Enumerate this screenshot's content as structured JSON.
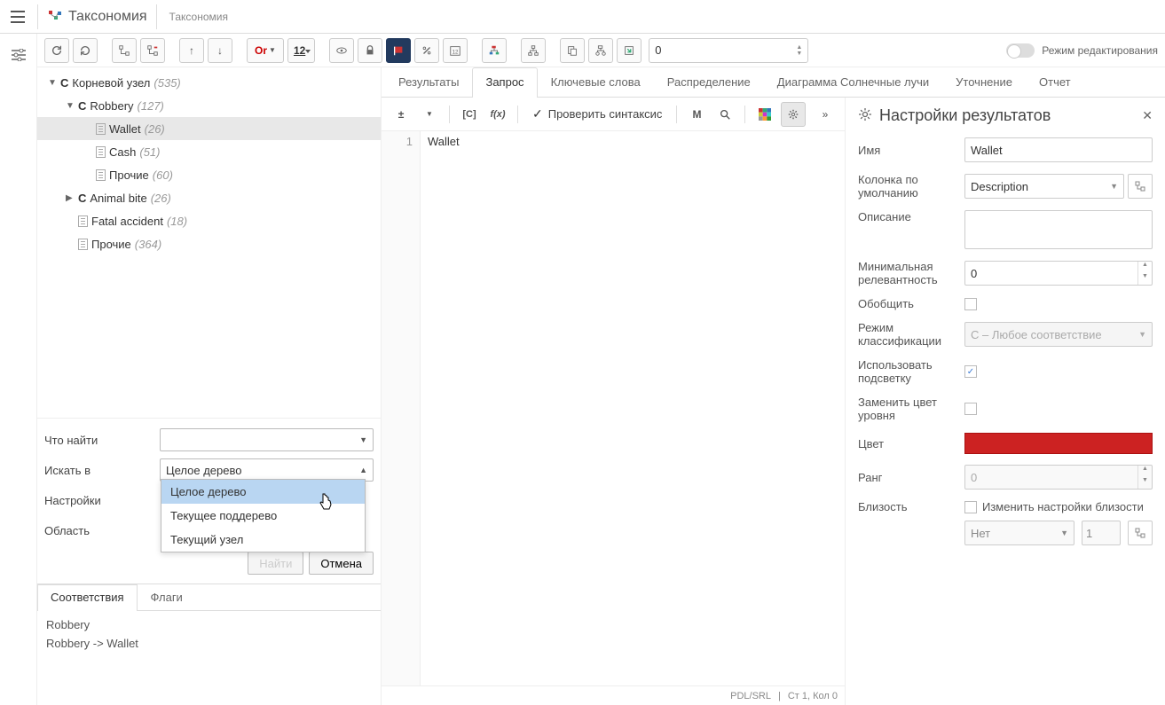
{
  "header": {
    "title": "Таксономия",
    "breadcrumb": "Таксономия"
  },
  "toolbar": {
    "or_label": "Or",
    "number_badge": "12",
    "spinner_value": "0",
    "edit_mode_label": "Режим редактирования"
  },
  "tree": {
    "nodes": [
      {
        "type": "C",
        "label": "Корневой узел",
        "count": "(535)",
        "expanded": true,
        "indent": 0
      },
      {
        "type": "C",
        "label": "Robbery",
        "count": "(127)",
        "expanded": true,
        "indent": 1
      },
      {
        "type": "doc",
        "label": "Wallet",
        "count": "(26)",
        "indent": 2,
        "selected": true
      },
      {
        "type": "doc",
        "label": "Cash",
        "count": "(51)",
        "indent": 2
      },
      {
        "type": "doc",
        "label": "Прочие",
        "count": "(60)",
        "indent": 2
      },
      {
        "type": "C",
        "label": "Animal bite",
        "count": "(26)",
        "expanded": false,
        "indent": 1
      },
      {
        "type": "doc",
        "label": "Fatal accident",
        "count": "(18)",
        "indent": 1
      },
      {
        "type": "doc",
        "label": "Прочие",
        "count": "(364)",
        "indent": 1
      }
    ]
  },
  "search_form": {
    "find_label": "Что найти",
    "search_in_label": "Искать в",
    "search_in_value": "Целое дерево",
    "settings_label": "Настройки",
    "scope_label": "Область",
    "find_button": "Найти",
    "cancel_button": "Отмена",
    "dropdown_options": [
      "Целое дерево",
      "Текущее поддерево",
      "Текущий узел"
    ]
  },
  "bottom_tabs": {
    "tab1": "Соответствия",
    "tab2": "Флаги",
    "matches": [
      "Robbery",
      "Robbery -> Wallet"
    ]
  },
  "main_tabs": {
    "tabs": [
      "Результаты",
      "Запрос",
      "Ключевые слова",
      "Распределение",
      "Диаграмма Солнечные лучи",
      "Уточнение",
      "Отчет"
    ],
    "active_index": 1
  },
  "editor_toolbar": {
    "bracket_label": "[C]",
    "fx_label": "f(x)",
    "check_syntax": "Проверить синтаксис",
    "m_label": "M"
  },
  "editor": {
    "line_number": "1",
    "code": "Wallet"
  },
  "statusbar": {
    "lang": "PDL/SRL",
    "pos": "Ст 1, Кол 0"
  },
  "settings_panel": {
    "title": "Настройки результатов",
    "name_label": "Имя",
    "name_value": "Wallet",
    "default_col_label": "Колонка по умолчанию",
    "default_col_value": "Description",
    "description_label": "Описание",
    "min_relevance_label": "Минимальная релевантность",
    "min_relevance_value": "0",
    "generalize_label": "Обобщить",
    "class_mode_label": "Режим классификации",
    "class_mode_value": "С – Любое соответствие",
    "use_highlight_label": "Использовать подсветку",
    "replace_color_label": "Заменить цвет уровня",
    "color_label": "Цвет",
    "color_value": "#cc2222",
    "rank_label": "Ранг",
    "rank_value": "0",
    "proximity_label": "Близость",
    "proximity_checkbox_label": "Изменить настройки близости",
    "proximity_select": "Нет",
    "proximity_num": "1"
  }
}
